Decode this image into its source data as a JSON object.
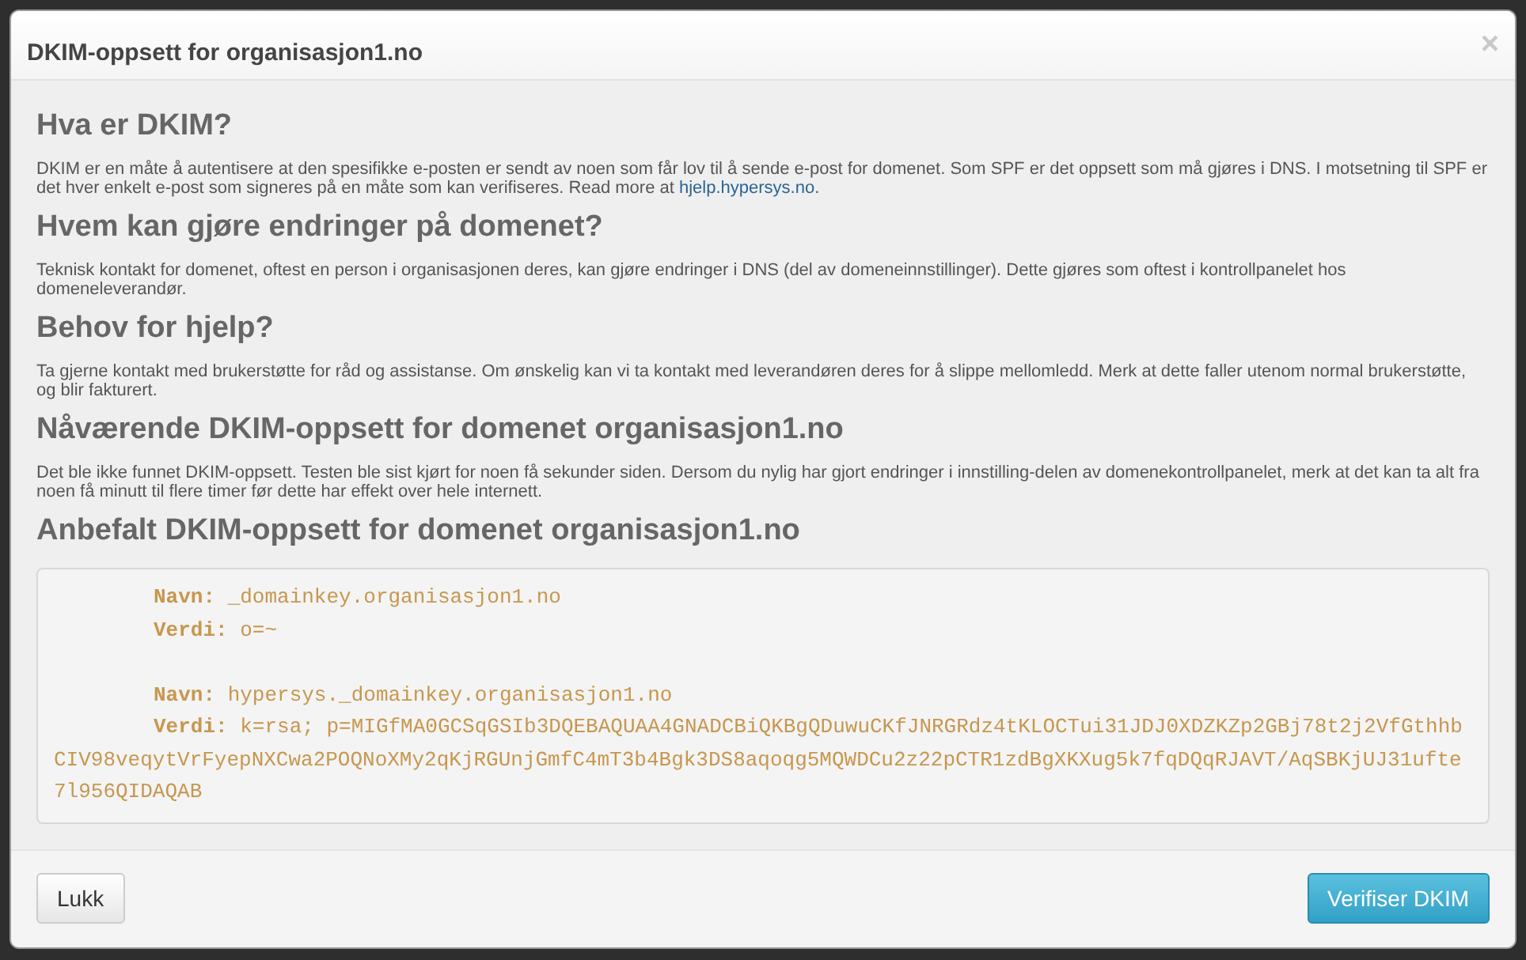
{
  "dialog": {
    "title": "DKIM-oppsett for organisasjon1.no",
    "close": "×"
  },
  "sections": [
    {
      "heading": "Hva er DKIM?",
      "text": "DKIM er en måte å autentisere at den spesifikke e-posten er sendt av noen som får lov til å sende e-post for domenet. Som SPF er det oppsett som må gjøres i DNS. I motsetning til SPF er det hver enkelt e-post som signeres på en måte som kan verifiseres. Read more at ",
      "link": "hjelp.hypersys.no",
      "after": "."
    },
    {
      "heading": "Hvem kan gjøre endringer på domenet?",
      "text": "Teknisk kontakt for domenet, oftest en person i organisasjonen deres, kan gjøre endringer i DNS (del av domeneinnstillinger). Dette gjøres som oftest i kontrollpanelet hos domeneleverandør."
    },
    {
      "heading": "Behov for hjelp?",
      "text": "Ta gjerne kontakt med brukerstøtte for råd og assistanse. Om ønskelig kan vi ta kontakt med leverandøren deres for å slippe mellomledd. Merk at dette faller utenom normal brukerstøtte, og blir fakturert."
    },
    {
      "heading": "Nåværende DKIM-oppsett for domenet organisasjon1.no",
      "text": "Det ble ikke funnet DKIM-oppsett. Testen ble sist kjørt for noen få sekunder siden. Dersom du nylig har gjort endringer i innstilling-delen av domenekontrollpanelet, merk at det kan ta alt fra noen få minutt til flere timer før dette har effekt over hele internett."
    },
    {
      "heading": "Anbefalt DKIM-oppsett for domenet organisasjon1.no"
    }
  ],
  "records": [
    {
      "name_label": "Navn:",
      "name": "_domainkey.organisasjon1.no",
      "value_label": "Verdi:",
      "value": "o=~"
    },
    {
      "name_label": "Navn:",
      "name": "hypersys._domainkey.organisasjon1.no",
      "value_label": "Verdi:",
      "value": "k=rsa; p=MIGfMA0GCSqGSIb3DQEBAQUAA4GNADCBiQKBgQDuwuCKfJNRGRdz4tKLOCTui31JDJ0XDZKZp2GBj78t2j2VfGthhbCIV98veqytVrFyepNXCwa2POQNoXMy2qKjRGUnjGmfC4mT3b4Bgk3DS8aqoqg5MQWDCu2z22pCTR1zdBgXKXug5k7fqDQqRJAVT/AqSBKjUJ31ufte7l956QIDAQAB"
    }
  ],
  "footer": {
    "close_button": "Lukk",
    "verify_button": "Verifiser DKIM"
  }
}
